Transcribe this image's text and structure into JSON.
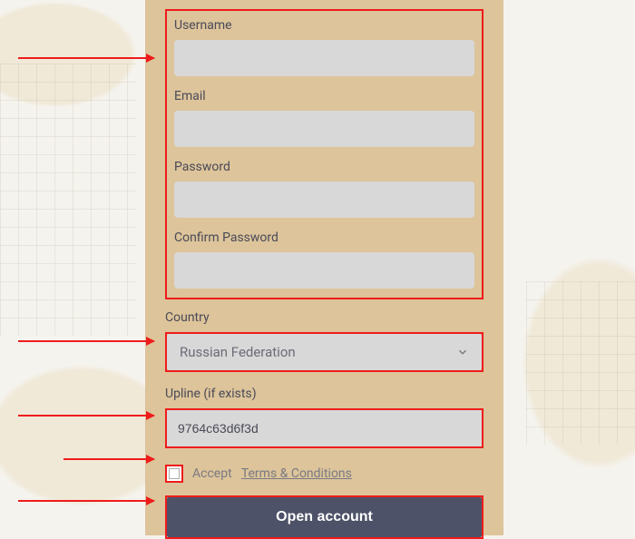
{
  "form": {
    "username": {
      "label": "Username",
      "value": ""
    },
    "email": {
      "label": "Email",
      "value": ""
    },
    "password": {
      "label": "Password",
      "value": ""
    },
    "confirm_password": {
      "label": "Confirm Password",
      "value": ""
    },
    "country": {
      "label": "Country",
      "selected": "Russian Federation"
    },
    "upline": {
      "label": "Upline (if exists)",
      "value": "9764c63d6f3d"
    },
    "terms": {
      "accept_text": "Accept",
      "link_text": "Terms & Conditions"
    },
    "submit_label": "Open account"
  },
  "colors": {
    "highlight": "#ee1c1c",
    "panel_bg": "#ddc49a",
    "input_bg": "#d8d8d8",
    "submit_bg": "#4d5268"
  }
}
